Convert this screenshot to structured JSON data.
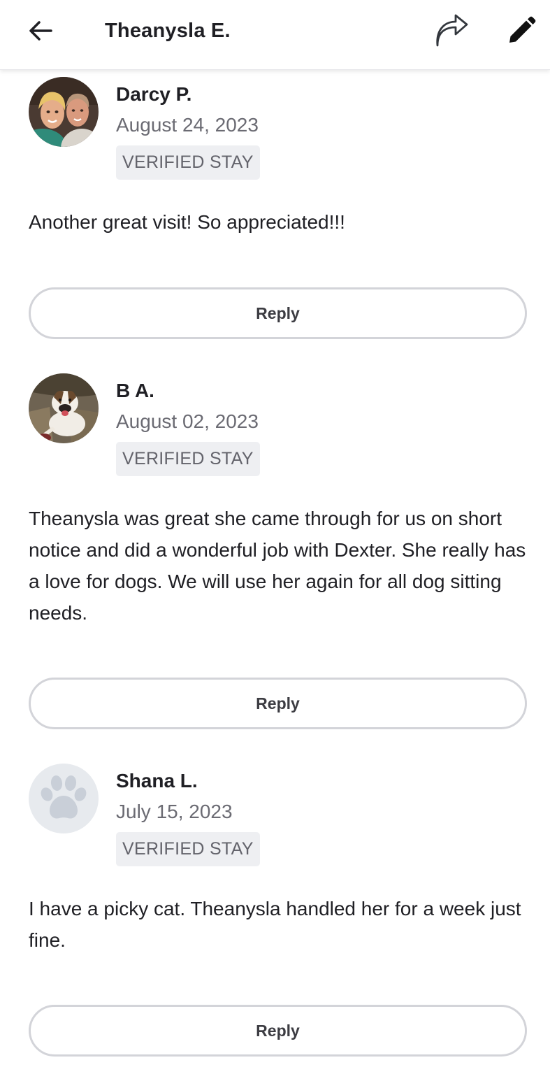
{
  "header": {
    "title": "Theanysla E.",
    "back_icon": "arrow-left-icon",
    "share_icon": "share-arrow-icon",
    "edit_icon": "pencil-icon"
  },
  "reviews": [
    {
      "name": "Darcy P.",
      "date": "August 24, 2023",
      "badge": "VERIFIED STAY",
      "text": "Another great visit! So appreciated!!!",
      "reply_label": "Reply",
      "avatar": "photo"
    },
    {
      "name": "B A.",
      "date": "August 02, 2023",
      "badge": "VERIFIED STAY",
      "text": "Theanysla was great she came through for us on short notice and did a wonderful job with Dexter. She really has a love for dogs. We will use her again for all dog sitting needs.",
      "reply_label": "Reply",
      "avatar": "photo"
    },
    {
      "name": "Shana L.",
      "date": "July 15, 2023",
      "badge": "VERIFIED STAY",
      "text": "I have a picky cat. Theanysla handled her for a week just fine.",
      "reply_label": "Reply",
      "avatar": "paw-icon"
    }
  ],
  "colors": {
    "text": "#1f1f24",
    "muted": "#6b6b73",
    "badge_bg": "#eeeff2",
    "button_border": "#d3d4d9",
    "paw": "#c9cfd8",
    "paw_bg": "#e7eaee"
  }
}
